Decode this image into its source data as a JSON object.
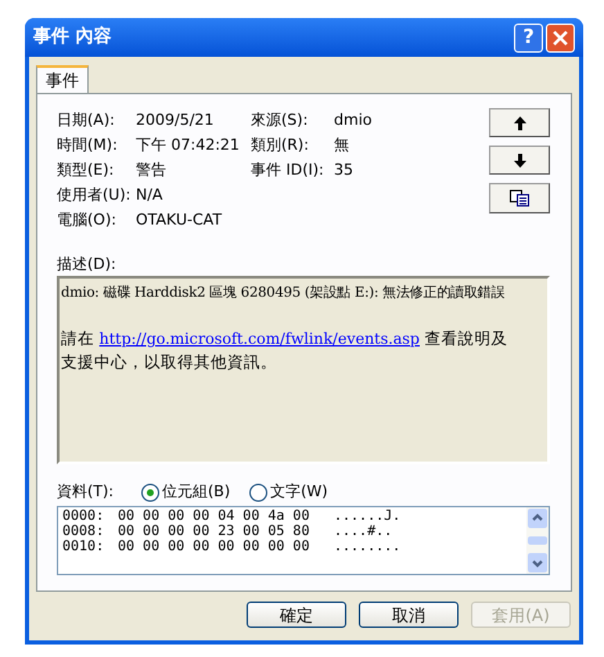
{
  "window": {
    "title": "事件 內容",
    "help": "?"
  },
  "tabs": [
    {
      "label": "事件",
      "selected": true
    }
  ],
  "fields": [
    [
      {
        "label": "日期(A):",
        "value": "2009/5/21"
      },
      {
        "label": "來源(S):",
        "value": "dmio"
      }
    ],
    [
      {
        "label": "時間(M):",
        "value": "下午 07:42:21"
      },
      {
        "label": "類別(R):",
        "value": "無"
      }
    ],
    [
      {
        "label": "類型(E):",
        "value": "警告"
      },
      {
        "label": "事件 ID(I):",
        "value": "35"
      }
    ],
    [
      {
        "label": "使用者(U):",
        "value": "N/A"
      }
    ],
    [
      {
        "label": "電腦(O):",
        "value": "OTAKU-CAT"
      }
    ]
  ],
  "description": {
    "label": "描述(D):",
    "text": "dmio: 磁碟 Harddisk2 區塊 6280495 (架設點 E:): 無法修正的讀取錯誤",
    "before_link": "請在",
    "link": "http://go.microsoft.com/fwlink/events.asp",
    "after_link": "查看說明及支援中心，以取得其他資訊。"
  },
  "data": {
    "label": "資料(T):",
    "formats": [
      {
        "label": "位元組(B)",
        "selected": true
      },
      {
        "label": "文字(W)",
        "selected": false
      }
    ],
    "rows": [
      {
        "offset": "0000:",
        "hex": "00 00 00 00 04 00 4a 00",
        "ascii": "......J."
      },
      {
        "offset": "0008:",
        "hex": "00 00 00 00 23 00 05 80",
        "ascii": "....#.."
      },
      {
        "offset": "0010:",
        "hex": "00 00 00 00 00 00 00 00",
        "ascii": "........"
      }
    ]
  },
  "buttons": [
    {
      "label": "確定",
      "disabled": false
    },
    {
      "label": "取消",
      "disabled": false
    },
    {
      "label": "套用(A)",
      "disabled": true
    }
  ]
}
